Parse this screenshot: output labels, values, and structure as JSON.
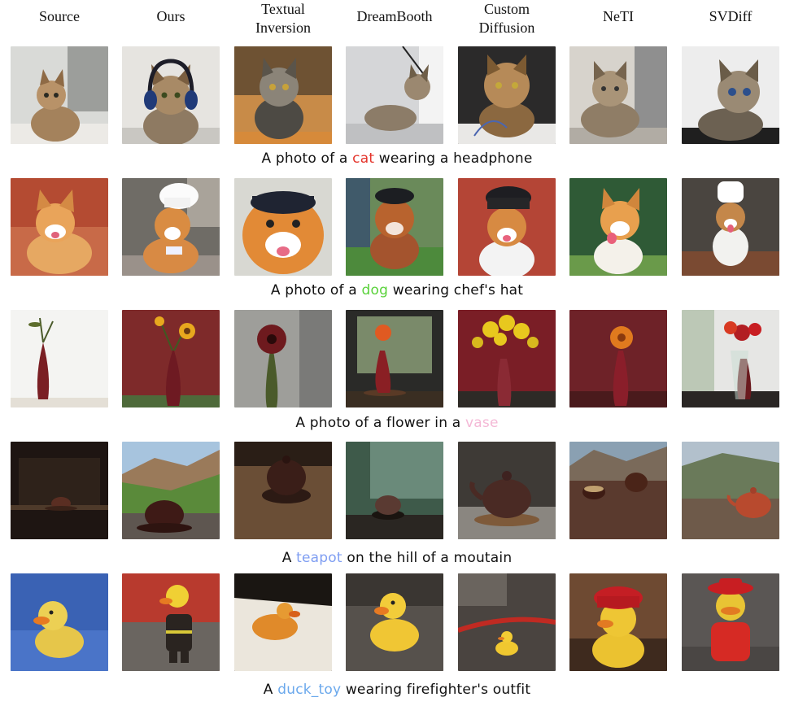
{
  "headers": [
    "Source",
    "Ours",
    "Textual\nInversion",
    "DreamBooth",
    "Custom\nDiffusion",
    "NeTI",
    "SVDiff"
  ],
  "rows": [
    {
      "caption": {
        "pre": "A photo of a ",
        "subject": "cat",
        "post": " wearing a headphone",
        "subject_color": "#e4342b"
      },
      "images": [
        "cat-source",
        "cat-headphone-ours",
        "cat-textual-inversion",
        "cat-dreambooth",
        "cat-custom-diffusion",
        "cat-neti",
        "cat-svdiff"
      ]
    },
    {
      "caption": {
        "pre": "A photo of a ",
        "subject": "dog",
        "post": " wearing chef's hat",
        "subject_color": "#5ad23b"
      },
      "images": [
        "dog-source",
        "dog-chef-ours",
        "dog-textual-inversion",
        "dog-dreambooth",
        "dog-custom-diffusion",
        "dog-neti",
        "dog-svdiff"
      ]
    },
    {
      "caption": {
        "pre": "A photo of a flower in a ",
        "subject": "vase",
        "post": "",
        "subject_color": "#f4b8d6"
      },
      "images": [
        "vase-source",
        "vase-flower-ours",
        "vase-textual-inversion",
        "vase-dreambooth",
        "vase-custom-diffusion",
        "vase-neti",
        "vase-svdiff"
      ]
    },
    {
      "caption": {
        "pre": "A ",
        "subject": "teapot",
        "post": " on the hill of a moutain",
        "subject_color": "#7f9ef2"
      },
      "images": [
        "teapot-source",
        "teapot-hill-ours",
        "teapot-textual-inversion",
        "teapot-dreambooth",
        "teapot-custom-diffusion",
        "teapot-neti",
        "teapot-svdiff"
      ]
    },
    {
      "caption": {
        "pre": "A ",
        "subject": "duck_toy",
        "post": " wearing firefighter's outfit",
        "subject_color": "#6aa8ec"
      },
      "images": [
        "duck-source",
        "duck-firefighter-ours",
        "duck-textual-inversion",
        "duck-dreambooth",
        "duck-custom-diffusion",
        "duck-neti",
        "duck-svdiff"
      ]
    }
  ]
}
